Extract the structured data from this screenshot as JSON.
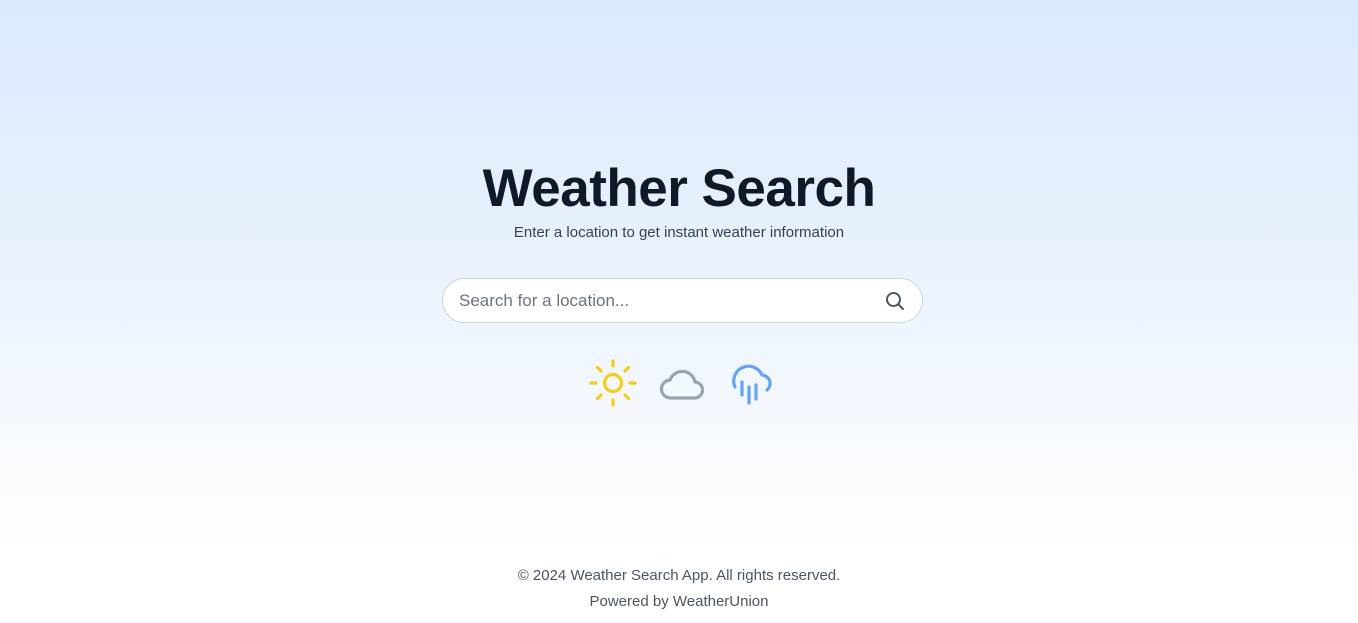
{
  "hero": {
    "title": "Weather Search",
    "subtitle": "Enter a location to get instant weather information"
  },
  "search": {
    "placeholder": "Search for a location...",
    "value": "",
    "button_icon": "search-icon"
  },
  "weather_icons": [
    {
      "name": "sun-icon",
      "color": "#facc15"
    },
    {
      "name": "cloud-icon",
      "color": "#9ca3af"
    },
    {
      "name": "rain-cloud-icon",
      "color": "#60a5fa"
    }
  ],
  "footer": {
    "copyright": "© 2024 Weather Search App. All rights reserved.",
    "powered_by": "Powered by WeatherUnion"
  },
  "colors": {
    "background_top": "#dbeafe",
    "title": "#111827",
    "sun": "#facc15",
    "cloud": "#9ca3af",
    "rain": "#60a5fa"
  }
}
